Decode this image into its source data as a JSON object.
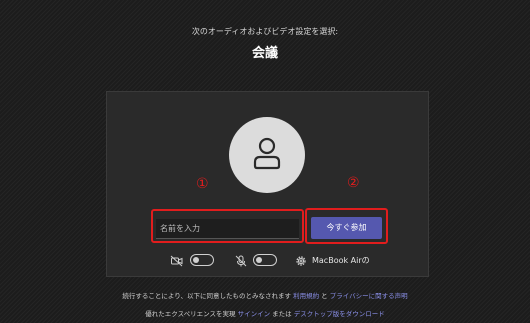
{
  "header": {
    "subtitle": "次のオーディオおよびビデオ設定を選択:",
    "title": "会議"
  },
  "preview": {
    "annotation_1": "①",
    "annotation_2": "②"
  },
  "name_input": {
    "placeholder": "名前を入力",
    "value": ""
  },
  "join_button": {
    "label": "今すぐ参加"
  },
  "controls": {
    "camera_toggle_state": "off",
    "mic_toggle_state": "off",
    "device_label": "MacBook Airの"
  },
  "footer": {
    "line1_prefix": "続行することにより、以下に同意したものとみなされます",
    "terms_link": "利用規約",
    "line1_and": "と",
    "privacy_link": "プライバシーに関する声明",
    "line2_prefix": "優れたエクスペリエンスを実現",
    "signin_link": "サインイン",
    "line2_or": "または",
    "desktop_link": "デスクトップ版をダウンロード"
  },
  "colors": {
    "background": "#1c1c1c",
    "panel": "#2a2a2a",
    "accent": "#5558af",
    "link": "#8a8fe8",
    "annotation": "#e11d1d"
  }
}
